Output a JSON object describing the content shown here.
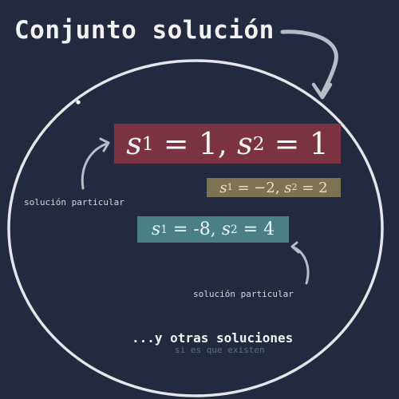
{
  "title": "Conjunto solución",
  "solutions": [
    {
      "s1_label": "s",
      "s1_index": "1",
      "s1_value": "1",
      "s2_label": "s",
      "s2_index": "2",
      "s2_value": "1"
    },
    {
      "s1_label": "s",
      "s1_index": "1",
      "s1_value": "−2",
      "s2_label": "s",
      "s2_index": "2",
      "s2_value": "2"
    },
    {
      "s1_label": "s",
      "s1_index": "1",
      "s1_value": "-8",
      "s2_label": "s",
      "s2_index": "2",
      "s2_value": "4"
    }
  ],
  "labels": {
    "particular_left": "solución particular",
    "particular_right": "solución particular",
    "others": "...y otras soluciones",
    "others_sub": "si es que existen"
  },
  "colors": {
    "background": "#232a3f",
    "main_box": "#7b3341",
    "mid_box": "#7d7254",
    "teal_box": "#4b7f86",
    "ellipse": "#e6e6ea",
    "arrow": "#b9bcc6"
  }
}
